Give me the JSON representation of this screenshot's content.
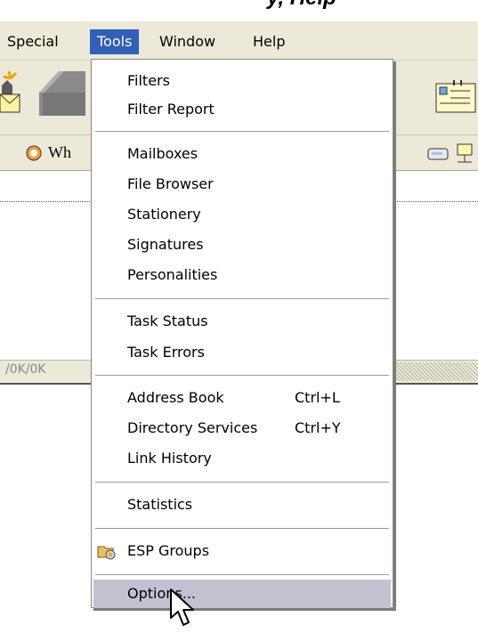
{
  "window": {
    "partial_title": "y, Help"
  },
  "menubar": {
    "items": [
      {
        "label": "Special"
      },
      {
        "label": "Tools"
      },
      {
        "label": "Window"
      },
      {
        "label": "Help"
      }
    ]
  },
  "toolbar2": {
    "partial_label": "Wh"
  },
  "statusbar": {
    "text": "/0K/0K"
  },
  "tools_menu": {
    "groups": [
      [
        {
          "label": "Filters"
        },
        {
          "label": "Filter Report"
        }
      ],
      [
        {
          "label": "Mailboxes"
        },
        {
          "label": "File Browser"
        },
        {
          "label": "Stationery"
        },
        {
          "label": "Signatures"
        },
        {
          "label": "Personalities"
        }
      ],
      [
        {
          "label": "Task Status"
        },
        {
          "label": "Task Errors"
        }
      ],
      [
        {
          "label": "Address Book",
          "shortcut": "Ctrl+L"
        },
        {
          "label": "Directory Services",
          "shortcut": "Ctrl+Y"
        },
        {
          "label": "Link History"
        }
      ],
      [
        {
          "label": "Statistics"
        }
      ],
      [
        {
          "label": "ESP Groups",
          "icon": "esp-groups-icon"
        }
      ],
      [
        {
          "label": "Options...",
          "highlighted": true
        }
      ]
    ]
  },
  "colors": {
    "menubar_bg": "#ece9d8",
    "active_menu_bg": "#315fba",
    "highlight_bg": "#c3c1d1"
  }
}
